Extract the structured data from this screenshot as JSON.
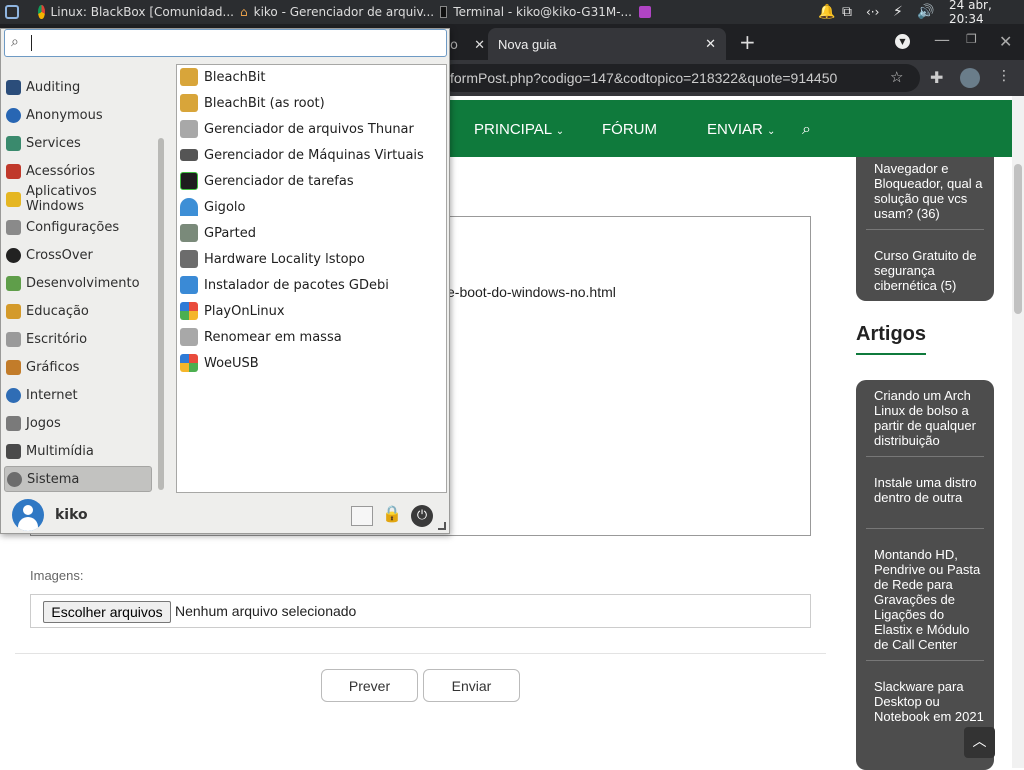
{
  "taskbar": {
    "windows": [
      "Linux: BlackBox [Comunidad...",
      "kiko - Gerenciador de arquiv...",
      "Terminal - kiko@kiko-G31M-..."
    ],
    "clock": "24 abr, 20:34"
  },
  "chrome": {
    "tab_new": "Nova guia",
    "tab_partial": "o",
    "url": "formPost.php?codigo=147&codtopico=218322&quote=914450"
  },
  "site": {
    "nav": [
      "PRINCIPAL",
      "FÓRUM",
      "ENVIAR"
    ],
    "textarea_visible": "e-boot-do-windows-no.html",
    "images_label": "Imagens:",
    "choose_files": "Escolher arquivos",
    "no_file": "Nenhum arquivo selecionado",
    "preview": "Prever",
    "send": "Enviar",
    "sidebar_top": [
      "Navegador e Bloqueador, qual a solução que vcs usam? (36)",
      "Curso Gratuito de segurança cibernética (5)"
    ],
    "articles_title": "Artigos",
    "articles": [
      "Criando um Arch Linux de bolso a partir de qualquer distribuição",
      "Instale uma distro dentro de outra",
      "Montando HD, Pendrive ou Pasta de Rede para Gravações de Ligações do Elastix e Módulo de Call Center",
      "Slackware para Desktop ou Notebook em 2021"
    ]
  },
  "menu": {
    "search_placeholder": "",
    "categories": [
      "Auditing",
      "Anonymous",
      "Services",
      "Acessórios",
      "Aplicativos Windows",
      "Configurações",
      "CrossOver",
      "Desenvolvimento",
      "Educação",
      "Escritório",
      "Gráficos",
      "Internet",
      "Jogos",
      "Multimídia",
      "Sistema"
    ],
    "apps": [
      "BleachBit",
      "BleachBit (as root)",
      "Gerenciador de arquivos Thunar",
      "Gerenciador de Máquinas Virtuais",
      "Gerenciador de tarefas",
      "Gigolo",
      "GParted",
      "Hardware Locality lstopo",
      "Instalador de pacotes GDebi",
      "PlayOnLinux",
      "Renomear em massa",
      "WoeUSB"
    ],
    "user": "kiko"
  }
}
